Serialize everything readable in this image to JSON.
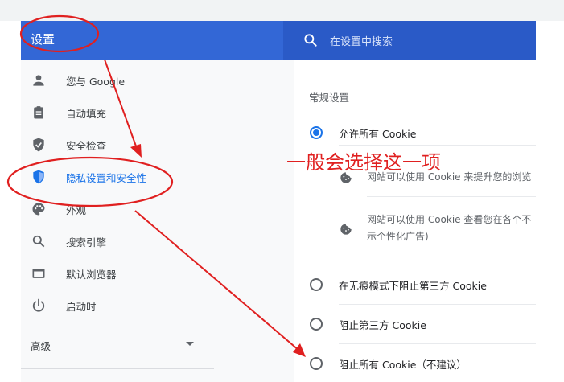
{
  "header": {
    "title": "设置"
  },
  "search": {
    "placeholder": "在设置中搜索"
  },
  "sidebar": {
    "items": [
      {
        "label": "您与 Google",
        "icon": "person-icon"
      },
      {
        "label": "自动填充",
        "icon": "clipboard-icon"
      },
      {
        "label": "安全检查",
        "icon": "shield-check-icon"
      },
      {
        "label": "隐私设置和安全性",
        "icon": "shield-icon",
        "active": true
      },
      {
        "label": "外观",
        "icon": "palette-icon"
      },
      {
        "label": "搜索引擎",
        "icon": "search-icon"
      },
      {
        "label": "默认浏览器",
        "icon": "browser-icon"
      },
      {
        "label": "启动时",
        "icon": "power-icon"
      }
    ],
    "advanced_label": "高级"
  },
  "content": {
    "section_title": "常规设置",
    "options": [
      {
        "label": "允许所有 Cookie",
        "selected": true
      },
      {
        "label": "在无痕模式下阻止第三方 Cookie",
        "selected": false
      },
      {
        "label": "阻止第三方 Cookie",
        "selected": false
      },
      {
        "label": "阻止所有 Cookie（不建议）",
        "selected": false
      }
    ],
    "details": [
      {
        "line1": "网站可以使用 Cookie 来提升您的浏览"
      },
      {
        "line1": "网站可以使用 Cookie 查看您在各个不",
        "line2": "示个性化广告)"
      }
    ]
  },
  "annotation": {
    "text": "一般会选择这一项"
  },
  "colors": {
    "header_blue": "#3367d6",
    "accent": "#1a73e8",
    "annotation_red": "#e02020"
  }
}
